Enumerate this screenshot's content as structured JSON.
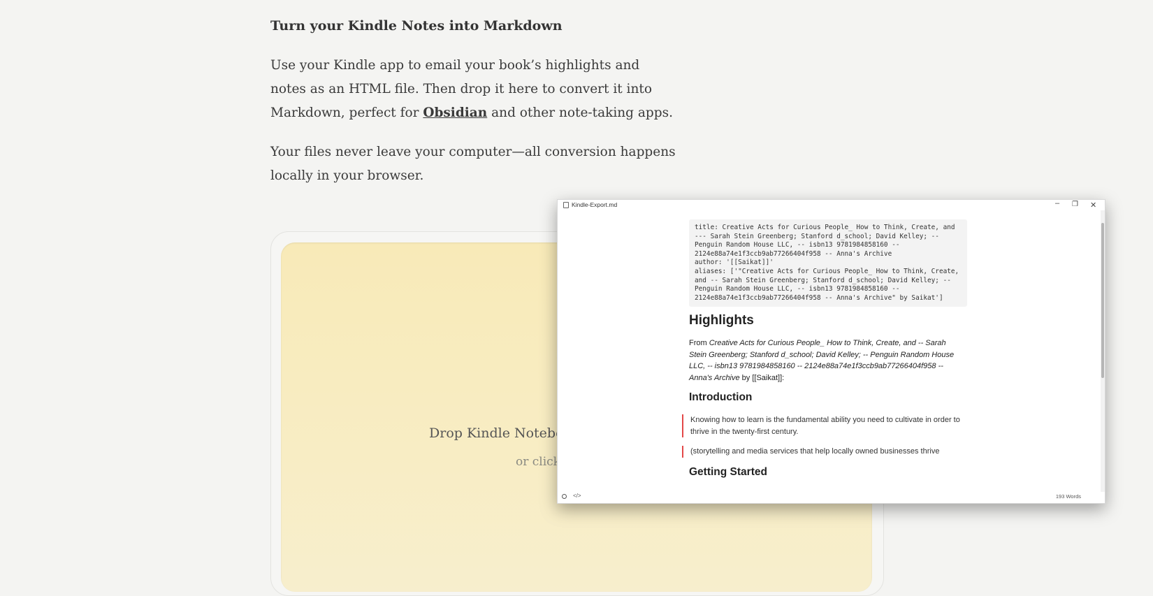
{
  "page": {
    "heading": "Turn your Kindle Notes into Markdown",
    "intro_before_link": "Use your Kindle app to email your book’s highlights and notes as an HTML file. Then drop it here to convert it into Markdown, perfect for ",
    "intro_link": "Obsidian",
    "intro_after_link": " and other note-taking apps.",
    "privacy_note": "Your files never leave your computer—all conversion happens locally in your browser."
  },
  "dropzone": {
    "title_visible": "Drop Kindle Notebo",
    "subtitle_visible": "or click"
  },
  "viewer": {
    "window_title": "Kindle-Export.md",
    "controls": {
      "minimize": "–",
      "restore": "❐",
      "close": "✕"
    },
    "frontmatter": "title: Creative Acts for Curious People_ How to Think, Create, and --- Sarah Stein Greenberg; Stanford d_school; David Kelley; -- Penguin Random House LLC, -- isbn13 9781984858160 -- 2124e88a74e1f3ccb9ab77266404f958 -- Anna's Archive\nauthor: '[[Saikat]]'\naliases: ['\"Creative Acts for Curious People_ How to Think, Create, and -- Sarah Stein Greenberg; Stanford d_school; David Kelley; -- Penguin Random House LLC, -- isbn13 9781984858160 -- 2124e88a74e1f3ccb9ab77266404f958 -- Anna's Archive\" by Saikat']",
    "highlights_heading": "Highlights",
    "from_prefix": "From ",
    "from_book": "Creative Acts for Curious People_ How to Think, Create, and -- Sarah Stein Greenberg; Stanford d_school; David Kelley; -- Penguin Random House LLC, -- isbn13 9781984858160 -- 2124e88a74e1f3ccb9ab77266404f958 -- Anna's Archive",
    "from_suffix": " by [[Saikat]]:",
    "intro_heading": "Introduction",
    "quote1": "Knowing how to learn is the fundamental ability you need to cultivate in order to thrive in the twenty-first century.",
    "quote2": "(storytelling and media services that help locally owned businesses thrive",
    "getting_started_heading": "Getting Started",
    "status": {
      "code_icon": "</>",
      "word_count": "193 Words"
    }
  },
  "colors": {
    "background": "#f4f4f2",
    "dropzone": "#f8eab8",
    "quote_border": "#e34848"
  }
}
